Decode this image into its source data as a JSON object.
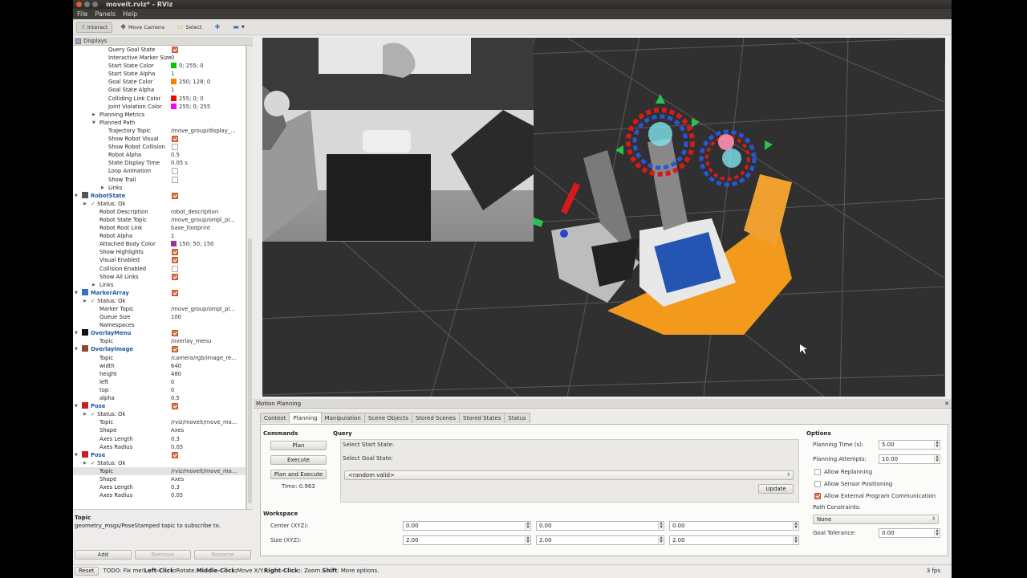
{
  "window": {
    "title": "moveit.rviz* - RViz"
  },
  "menu": [
    "File",
    "Panels",
    "Help"
  ],
  "toolbar": {
    "interact": "Interact",
    "move_camera": "Move Camera",
    "select": "Select"
  },
  "displays": {
    "title": "Displays",
    "rows": [
      {
        "name": "Query Goal State",
        "check": true,
        "indent": 3
      },
      {
        "name": "Interactive Marker Size",
        "value": "0",
        "indent": 3
      },
      {
        "name": "Start State Color",
        "value": "0; 255; 0",
        "swatch": "#00c800",
        "indent": 3
      },
      {
        "name": "Start State Alpha",
        "value": "1",
        "indent": 3
      },
      {
        "name": "Goal State Color",
        "value": "250; 128; 0",
        "swatch": "#fa8000",
        "indent": 3
      },
      {
        "name": "Goal State Alpha",
        "value": "1",
        "indent": 3
      },
      {
        "name": "Colliding Link Color",
        "value": "255; 0; 0",
        "swatch": "#ff0000",
        "indent": 3
      },
      {
        "name": "Joint Violation Color",
        "value": "255; 0; 255",
        "swatch": "#ff00ff",
        "indent": 3
      },
      {
        "name": "Planning Metrics",
        "arrow": "▶",
        "indent": 2
      },
      {
        "name": "Planned Path",
        "arrow": "▼",
        "indent": 2
      },
      {
        "name": "Trajectory Topic",
        "value": "/move_group/display_...",
        "indent": 3
      },
      {
        "name": "Show Robot Visual",
        "check": true,
        "indent": 3
      },
      {
        "name": "Show Robot Collision",
        "check": false,
        "indent": 3
      },
      {
        "name": "Robot Alpha",
        "value": "0.5",
        "indent": 3
      },
      {
        "name": "State Display Time",
        "value": "0.05 s",
        "indent": 3
      },
      {
        "name": "Loop Animation",
        "check": false,
        "indent": 3
      },
      {
        "name": "Show Trail",
        "check": false,
        "indent": 3
      },
      {
        "name": "Links",
        "arrow": "▶",
        "indent": 3
      },
      {
        "name": "RobotState",
        "plugin": true,
        "check": true,
        "arrow": "▼",
        "icon": "robot",
        "indent": 0
      },
      {
        "name": "Status: Ok",
        "arrow": "▶",
        "ok": true,
        "indent": 1
      },
      {
        "name": "Robot Description",
        "value": "robot_description",
        "indent": 2
      },
      {
        "name": "Robot State Topic",
        "value": "/move_group/ompl_pl...",
        "indent": 2
      },
      {
        "name": "Robot Root Link",
        "value": "base_footprint",
        "indent": 2
      },
      {
        "name": "Robot Alpha",
        "value": "1",
        "indent": 2
      },
      {
        "name": "Attached Body Color",
        "value": "150; 50; 150",
        "swatch": "#963296",
        "indent": 2
      },
      {
        "name": "Show Highlights",
        "check": true,
        "indent": 2
      },
      {
        "name": "Visual Enabled",
        "check": true,
        "indent": 2
      },
      {
        "name": "Collision Enabled",
        "check": false,
        "indent": 2
      },
      {
        "name": "Show All Links",
        "check": true,
        "indent": 2
      },
      {
        "name": "Links",
        "arrow": "▶",
        "indent": 2
      },
      {
        "name": "MarkerArray",
        "plugin": true,
        "check": true,
        "arrow": "▼",
        "icon": "marker",
        "indent": 0
      },
      {
        "name": "Status: Ok",
        "arrow": "▶",
        "ok": true,
        "indent": 1
      },
      {
        "name": "Marker Topic",
        "value": "/move_group/ompl_pl...",
        "indent": 2
      },
      {
        "name": "Queue Size",
        "value": "100",
        "indent": 2
      },
      {
        "name": "Namespaces",
        "indent": 2
      },
      {
        "name": "OverlayMenu",
        "plugin": true,
        "check": true,
        "arrow": "▼",
        "icon": "menu",
        "indent": 0
      },
      {
        "name": "Topic",
        "value": "/overlay_menu",
        "indent": 2
      },
      {
        "name": "OverlayImage",
        "plugin": true,
        "check": true,
        "arrow": "▼",
        "icon": "image",
        "indent": 0
      },
      {
        "name": "Topic",
        "value": "/camera/rgb/image_re...",
        "indent": 2
      },
      {
        "name": "width",
        "value": "640",
        "indent": 2
      },
      {
        "name": "height",
        "value": "480",
        "indent": 2
      },
      {
        "name": "left",
        "value": "0",
        "indent": 2
      },
      {
        "name": "top",
        "value": "0",
        "indent": 2
      },
      {
        "name": "alpha",
        "value": "0.5",
        "indent": 2
      },
      {
        "name": "Pose",
        "plugin": true,
        "check": true,
        "arrow": "▼",
        "icon": "pose",
        "indent": 0
      },
      {
        "name": "Status: Ok",
        "arrow": "▶",
        "ok": true,
        "indent": 1
      },
      {
        "name": "Topic",
        "value": "/rviz/moveit/move_ma...",
        "indent": 2
      },
      {
        "name": "Shape",
        "value": "Axes",
        "indent": 2
      },
      {
        "name": "Axes Length",
        "value": "0.3",
        "indent": 2
      },
      {
        "name": "Axes Radius",
        "value": "0.05",
        "indent": 2
      },
      {
        "name": "Pose",
        "plugin": true,
        "check": true,
        "arrow": "▼",
        "icon": "pose",
        "indent": 0
      },
      {
        "name": "Status: Ok",
        "arrow": "▶",
        "ok": true,
        "indent": 1
      },
      {
        "name": "Topic",
        "value": "/rviz/moveit/move_ma...",
        "selected": true,
        "indent": 2
      },
      {
        "name": "Shape",
        "value": "Axes",
        "indent": 2
      },
      {
        "name": "Axes Length",
        "value": "0.3",
        "indent": 2
      },
      {
        "name": "Axes Radius",
        "value": "0.05",
        "indent": 2
      }
    ]
  },
  "description": {
    "title": "Topic",
    "text": "geometry_msgs/PoseStamped topic to subscribe to."
  },
  "display_buttons": {
    "add": "Add",
    "remove": "Remove",
    "rename": "Rename"
  },
  "motion_planning": {
    "title": "Motion Planning",
    "tabs": [
      "Context",
      "Planning",
      "Manipulation",
      "Scene Objects",
      "Stored Scenes",
      "Stored States",
      "Status"
    ],
    "active_tab": "Planning",
    "commands": {
      "title": "Commands",
      "plan": "Plan",
      "execute": "Execute",
      "plan_execute": "Plan and Execute",
      "time": "Time: 0.963"
    },
    "query": {
      "title": "Query",
      "start_state": "Select Start State:",
      "goal_state": "Select Goal State:",
      "goal_value": "<random valid>",
      "update": "Update"
    },
    "workspace": {
      "title": "Workspace",
      "center_label": "Center (XYZ):",
      "center": [
        "0.00",
        "0.00",
        "0.00"
      ],
      "size_label": "Size (XYZ):",
      "size": [
        "2.00",
        "2.00",
        "2.00"
      ]
    },
    "options": {
      "title": "Options",
      "planning_time_label": "Planning Time (s):",
      "planning_time": "5.00",
      "attempts_label": "Planning Attempts:",
      "attempts": "10.00",
      "allow_replanning": "Allow Replanning",
      "allow_sensor": "Allow Sensor Positioning",
      "allow_external": "Allow External Program Communication",
      "path_constraints_label": "Path Constraints:",
      "path_constraints": "None",
      "goal_tolerance_label": "Goal Tolerance:",
      "goal_tolerance": "0.00"
    }
  },
  "status_bar": {
    "reset": "Reset",
    "todo": "TODO: Fix me! ",
    "left_click": "Left-Click:",
    "rotate": " Rotate. ",
    "middle_click": "Middle-Click:",
    "move": " Move X/Y. ",
    "right_click": "Right-Click:",
    "zoom": ": Zoom. ",
    "shift": "Shift",
    "more": ": More options.",
    "fps": "3 fps"
  }
}
